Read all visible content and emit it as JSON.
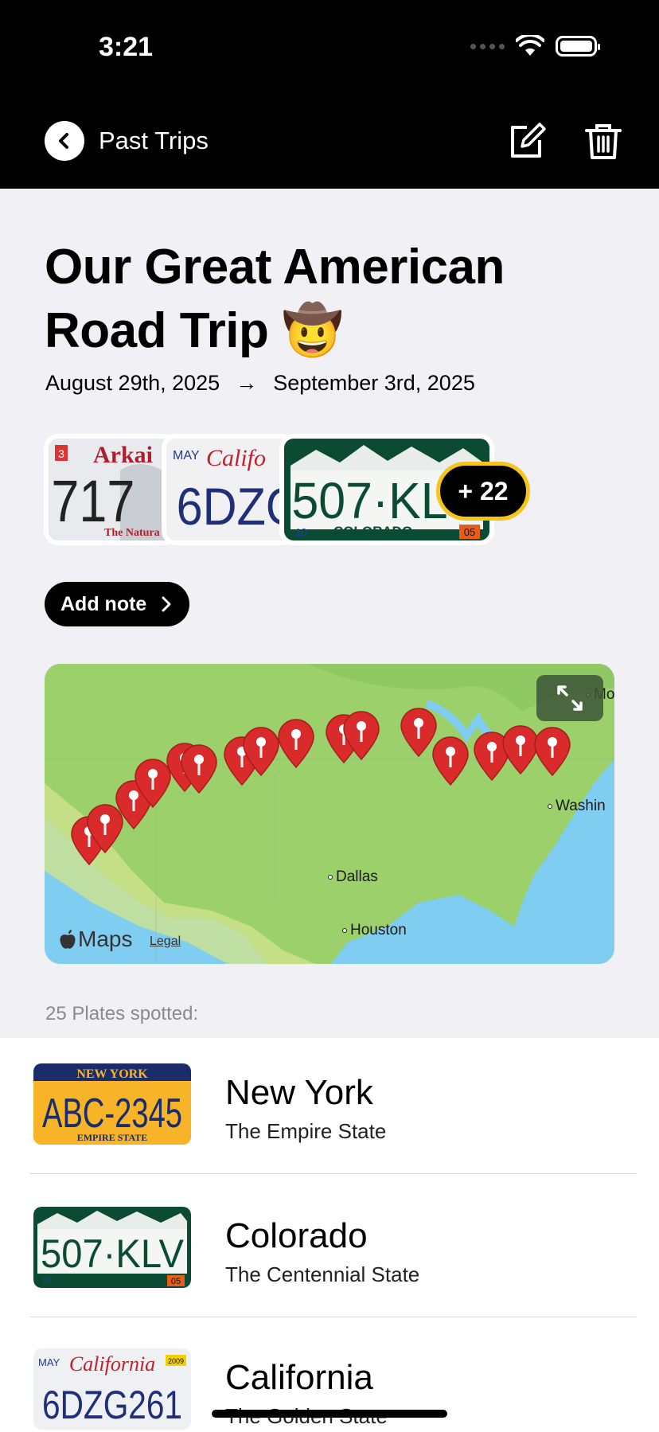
{
  "status_bar": {
    "time": "3:21"
  },
  "nav": {
    "back_label": "Past Trips"
  },
  "trip": {
    "title_line1": "Our Great American",
    "title_line2": "Road Trip",
    "title_emoji": "🤠",
    "start_date": "August 29th, 2025",
    "arrow": "→",
    "end_date": "September 3rd, 2025",
    "more_count": "+ 22"
  },
  "stack_plates": [
    {
      "state": "Arkansas",
      "top": "Arkai",
      "number": "717",
      "bottom": "The Natura",
      "sticker": "3"
    },
    {
      "state": "California",
      "top": "Califo",
      "number": "6DZG",
      "month": "MAY"
    },
    {
      "state": "Colorado",
      "number": "507·KL",
      "bottom": "COLORADO",
      "left_tag": "10",
      "right_tag": "05"
    }
  ],
  "add_note_label": "Add note",
  "map": {
    "cities": [
      "Dallas",
      "Houston",
      "Washin",
      "Mo"
    ],
    "logo": "Maps",
    "legal": "Legal"
  },
  "plates_spotted_label": "25 Plates spotted:",
  "plates": [
    {
      "state": "New York",
      "nickname": "The Empire State",
      "plate_top": "NEW YORK",
      "plate_number": "ABC-2345",
      "plate_bottom": "EMPIRE STATE"
    },
    {
      "state": "Colorado",
      "nickname": "The Centennial State",
      "plate_number": "507·KLV",
      "plate_bottom": "COLORADO",
      "left_tag": "10",
      "right_tag": "05"
    },
    {
      "state": "California",
      "nickname": "The Golden State",
      "plate_top": "California",
      "plate_number": "6DZG261",
      "month": "MAY",
      "year": "2009"
    }
  ],
  "colors": {
    "accent_badge": "#f5c518",
    "pin": "#d92b2b",
    "land": "#9bd06a",
    "water": "#7fcdf0"
  }
}
